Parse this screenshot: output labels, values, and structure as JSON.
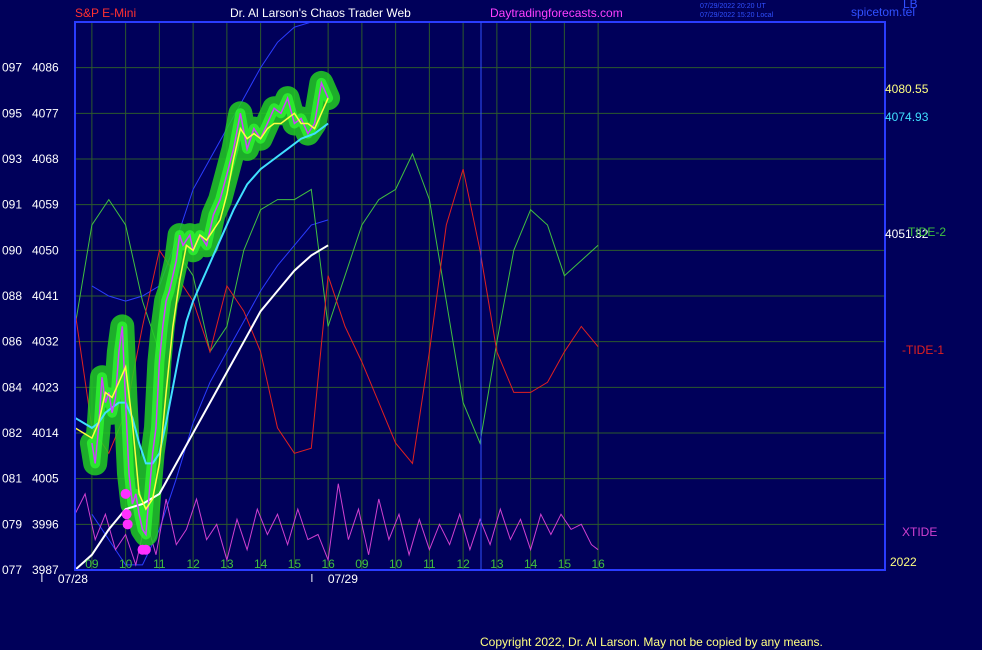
{
  "header": {
    "symbol": "S&P E-Mini",
    "site": "Dr. Al Larson's Chaos Trader Web",
    "url": "Daytradingforecasts.com",
    "timestamp_ut": "07/29/2022 20:20 UT",
    "timestamp_local": "07/29/2022 15:20 Local",
    "brand": "spicetom.tel",
    "brand_suffix": "LB"
  },
  "footer": {
    "copyright": "Copyright 2022, Dr. Al Larson. May not be copied by any means."
  },
  "colors": {
    "background": "#00005a",
    "border": "#2a3cff",
    "grid": "#2c5a2c",
    "price": "#d040ff",
    "yellow_avg": "#ffff40",
    "cyan_avg": "#40e0ff",
    "white_avg": "#ffffff",
    "tide1": "#e02020",
    "tide2": "#40c040",
    "xtide": "#d040d0",
    "halo": "#22cc22",
    "halo_bright": "#30ff30",
    "band": "#2a3cff"
  },
  "chart_data": {
    "type": "line",
    "xlim": [
      8.5,
      32.5
    ],
    "ylim": [
      3987,
      4095
    ],
    "x_tick_labels": [
      {
        "x": 9,
        "label": "09"
      },
      {
        "x": 10,
        "label": "10"
      },
      {
        "x": 11,
        "label": "11"
      },
      {
        "x": 12,
        "label": "12"
      },
      {
        "x": 13,
        "label": "13"
      },
      {
        "x": 14,
        "label": "14"
      },
      {
        "x": 15,
        "label": "15"
      },
      {
        "x": 16,
        "label": "16"
      },
      {
        "x": 17,
        "label": "09"
      },
      {
        "x": 18,
        "label": "10"
      },
      {
        "x": 19,
        "label": "11"
      },
      {
        "x": 20,
        "label": "12"
      },
      {
        "x": 21,
        "label": "13"
      },
      {
        "x": 22,
        "label": "14"
      },
      {
        "x": 23,
        "label": "15"
      },
      {
        "x": 24,
        "label": "16"
      }
    ],
    "date_labels": [
      {
        "x": 9,
        "label": "07/28"
      },
      {
        "x": 17,
        "label": "07/29"
      }
    ],
    "year_label": "2022",
    "y_tick_labels": [
      {
        "y": 3987,
        "code": "077",
        "label": "3987"
      },
      {
        "y": 3996,
        "code": "079",
        "label": "3996"
      },
      {
        "y": 4005,
        "code": "081",
        "label": "4005"
      },
      {
        "y": 4014,
        "code": "082",
        "label": "4014"
      },
      {
        "y": 4023,
        "code": "084",
        "label": "4023"
      },
      {
        "y": 4032,
        "code": "086",
        "label": "4032"
      },
      {
        "y": 4041,
        "code": "088",
        "label": "4041"
      },
      {
        "y": 4050,
        "code": "090",
        "label": "4050"
      },
      {
        "y": 4059,
        "code": "091",
        "label": "4059"
      },
      {
        "y": 4068,
        "code": "093",
        "label": "4068"
      },
      {
        "y": 4077,
        "code": "095",
        "label": "4077"
      },
      {
        "y": 4086,
        "code": "097",
        "label": "4086"
      }
    ],
    "right_labels": {
      "price_last": "4080.55",
      "cyan_last": "4074.93",
      "white_last": "4051.32",
      "tide2": "TIDE-2",
      "tide1": "-TIDE-1",
      "xtide": "XTIDE"
    },
    "series": [
      {
        "key": "price",
        "x": [
          9.0,
          9.1,
          9.2,
          9.3,
          9.4,
          9.5,
          9.6,
          9.7,
          9.8,
          9.9,
          10.0,
          10.1,
          10.2,
          10.3,
          10.4,
          10.5,
          10.6,
          10.7,
          10.8,
          10.9,
          11.0,
          11.1,
          11.2,
          11.3,
          11.4,
          11.5,
          11.6,
          11.7,
          11.8,
          11.9,
          12.0,
          12.2,
          12.4,
          12.6,
          12.8,
          13.0,
          13.2,
          13.4,
          13.6,
          13.8,
          14.0,
          14.2,
          14.4,
          14.6,
          14.8,
          15.0,
          15.2,
          15.4,
          15.6,
          15.8,
          16.0
        ],
        "values": [
          4012,
          4008,
          4015,
          4025,
          4020,
          4022,
          4018,
          4021,
          4030,
          4035,
          4020,
          4006,
          4000,
          4002,
          3998,
          3995,
          3994,
          4002,
          4010,
          4015,
          4028,
          4035,
          4040,
          4042,
          4045,
          4048,
          4053,
          4051,
          4052,
          4053,
          4050,
          4053,
          4051,
          4057,
          4060,
          4065,
          4070,
          4077,
          4070,
          4074,
          4072,
          4075,
          4078,
          4077,
          4080,
          4075,
          4076,
          4073,
          4075,
          4083,
          4080
        ]
      },
      {
        "key": "yellow_avg",
        "x": [
          8.5,
          9.0,
          9.2,
          9.4,
          9.6,
          9.8,
          10.0,
          10.2,
          10.4,
          10.6,
          10.8,
          11.0,
          11.2,
          11.4,
          11.6,
          11.8,
          12.0,
          12.2,
          12.4,
          12.6,
          12.8,
          13.0,
          13.2,
          13.4,
          13.6,
          13.8,
          14.0,
          14.2,
          14.4,
          14.6,
          14.8,
          15.0,
          15.2,
          15.4,
          15.6,
          15.8,
          16.0
        ],
        "values": [
          4015,
          4013,
          4016,
          4022,
          4021,
          4024,
          4027,
          4016,
          4002,
          3999,
          4001,
          4008,
          4022,
          4035,
          4044,
          4051,
          4050,
          4053,
          4052,
          4054,
          4056,
          4061,
          4068,
          4074,
          4072,
          4073,
          4072,
          4074,
          4075,
          4075,
          4076,
          4077,
          4075,
          4075,
          4074,
          4077,
          4080
        ]
      },
      {
        "key": "cyan_avg",
        "x": [
          8.5,
          9.0,
          9.2,
          9.4,
          9.6,
          9.8,
          10.0,
          10.2,
          10.4,
          10.6,
          10.8,
          11.0,
          11.2,
          11.4,
          11.6,
          11.8,
          12.0,
          12.4,
          12.8,
          13.2,
          13.6,
          14.0,
          14.4,
          14.8,
          15.2,
          15.6,
          16.0
        ],
        "values": [
          4017,
          4015,
          4016,
          4018,
          4019,
          4020,
          4020,
          4017,
          4012,
          4008,
          4008,
          4010,
          4016,
          4023,
          4030,
          4036,
          4040,
          4046,
          4052,
          4058,
          4063,
          4066,
          4068,
          4070,
          4072,
          4073,
          4075
        ]
      },
      {
        "key": "white_avg",
        "x": [
          8.5,
          9.0,
          9.5,
          10.0,
          10.5,
          11.0,
          11.5,
          12.0,
          12.5,
          13.0,
          13.5,
          14.0,
          14.5,
          15.0,
          15.5,
          16.0
        ],
        "values": [
          3987,
          3990,
          3995,
          3999,
          4000,
          4002,
          4008,
          4014,
          4020,
          4026,
          4032,
          4038,
          4042,
          4046,
          4049,
          4051
        ]
      },
      {
        "key": "tide2",
        "x": [
          8.5,
          9.0,
          9.5,
          10.0,
          10.5,
          11.0,
          11.5,
          12.0,
          12.5,
          13.0,
          13.5,
          14.0,
          14.5,
          15.0,
          15.5,
          16.0,
          16.5,
          17.0,
          17.5,
          18.0,
          18.5,
          19.0,
          19.5,
          20.0,
          20.5,
          21.0,
          21.5,
          22.0,
          22.5,
          23.0,
          23.5,
          24.0
        ],
        "values": [
          4035,
          4055,
          4060,
          4055,
          4040,
          4030,
          4050,
          4045,
          4030,
          4035,
          4050,
          4058,
          4060,
          4060,
          4062,
          4035,
          4045,
          4055,
          4060,
          4062,
          4069,
          4060,
          4040,
          4020,
          4012,
          4032,
          4050,
          4058,
          4055,
          4045,
          4048,
          4051
        ]
      },
      {
        "key": "tide1",
        "x": [
          8.5,
          9.0,
          9.5,
          10.0,
          10.5,
          11.0,
          11.5,
          12.0,
          12.5,
          13.0,
          13.5,
          14.0,
          14.5,
          15.0,
          15.5,
          16.0,
          16.5,
          17.0,
          17.5,
          18.0,
          18.5,
          19.0,
          19.5,
          20.0,
          20.5,
          21.0,
          21.5,
          22.0,
          22.5,
          23.0,
          23.5,
          24.0
        ],
        "values": [
          4038,
          4015,
          4010,
          4018,
          4035,
          4050,
          4045,
          4040,
          4030,
          4043,
          4038,
          4030,
          4015,
          4010,
          4011,
          4045,
          4035,
          4028,
          4020,
          4012,
          4008,
          4030,
          4055,
          4066,
          4050,
          4030,
          4022,
          4022,
          4024,
          4030,
          4035,
          4031
        ]
      },
      {
        "key": "xtide",
        "x": [
          8.5,
          8.8,
          9.1,
          9.4,
          9.7,
          10.0,
          10.3,
          10.6,
          10.9,
          11.2,
          11.5,
          11.8,
          12.1,
          12.4,
          12.7,
          13.0,
          13.3,
          13.6,
          13.9,
          14.2,
          14.5,
          14.8,
          15.1,
          15.4,
          15.7,
          16.0,
          16.3,
          16.6,
          16.9,
          17.2,
          17.5,
          17.8,
          18.1,
          18.4,
          18.7,
          19.0,
          19.3,
          19.6,
          19.9,
          20.2,
          20.5,
          20.8,
          21.1,
          21.4,
          21.7,
          22.0,
          22.3,
          22.6,
          22.9,
          23.2,
          23.5,
          23.8,
          24.0
        ],
        "values": [
          3998,
          4002,
          3993,
          3998,
          3991,
          3994,
          3988,
          3997,
          3990,
          4001,
          3992,
          3995,
          4001,
          3993,
          3996,
          3989,
          3997,
          3991,
          3999,
          3994,
          3998,
          3992,
          3999,
          3993,
          3994,
          3989,
          4004,
          3993,
          3999,
          3990,
          4001,
          3993,
          3998,
          3990,
          3997,
          3991,
          3996,
          3992,
          3998,
          3991,
          3997,
          3992,
          3999,
          3993,
          3997,
          3991,
          3998,
          3994,
          3998,
          3995,
          3996,
          3992,
          3991
        ]
      },
      {
        "key": "band_upper",
        "x": [
          9.0,
          9.5,
          10.0,
          10.5,
          11.0,
          11.5,
          12.0,
          12.5,
          13.0,
          13.5,
          14.0,
          14.5,
          15.0,
          15.5,
          16.0
        ],
        "values": [
          4043,
          4041,
          4040,
          4041,
          4043,
          4052,
          4062,
          4068,
          4074,
          4080,
          4086,
          4091,
          4094,
          4095,
          4095
        ]
      },
      {
        "key": "band_lower",
        "x": [
          9.0,
          9.5,
          10.0,
          10.5,
          11.0,
          11.5,
          12.0,
          12.5,
          13.0,
          13.5,
          14.0,
          14.5,
          15.0,
          15.5,
          16.0
        ],
        "values": [
          3998,
          3993,
          3988,
          3988,
          3995,
          4005,
          4016,
          4024,
          4030,
          4036,
          4042,
          4047,
          4051,
          4055,
          4056
        ]
      }
    ],
    "markers": [
      {
        "x": 10.0,
        "y": 4002
      },
      {
        "x": 10.03,
        "y": 3998
      },
      {
        "x": 10.06,
        "y": 3996
      },
      {
        "x": 10.5,
        "y": 3991
      },
      {
        "x": 10.6,
        "y": 3991
      }
    ]
  }
}
